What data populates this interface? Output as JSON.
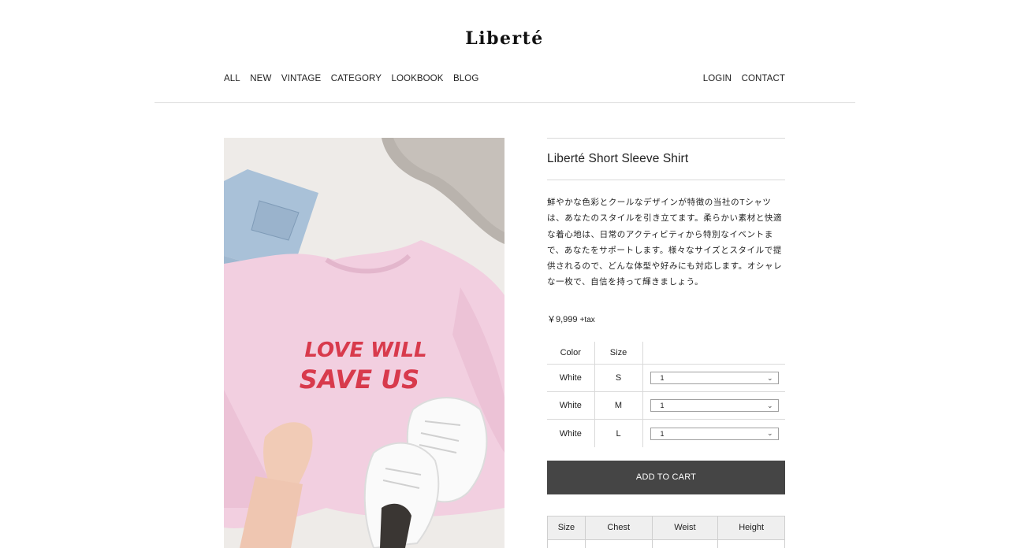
{
  "brand": "Liberté",
  "nav": {
    "left": [
      "ALL",
      "NEW",
      "VINTAGE",
      "CATEGORY",
      "LOOKBOOK",
      "BLOG"
    ],
    "right": [
      "LOGIN",
      "CONTACT"
    ]
  },
  "photo": {
    "print_line1": "LOVE WILL",
    "print_line2": "SAVE US"
  },
  "product": {
    "title": "Liberté Short Sleeve Shirt",
    "description": "鮮やかな色彩とクールなデザインが特徴の当社のTシャツは、あなたのスタイルを引き立てます。柔らかい素材と快適な着心地は、日常のアクティビティから特別なイベントまで、あなたをサポートします。様々なサイズとスタイルで提供されるので、どんな体型や好みにも対応します。オシャレな一枚で、自信を持って輝きましょう。",
    "price": "￥9,999",
    "tax": "+tax"
  },
  "variants": {
    "headers": [
      "Color",
      "Size"
    ],
    "rows": [
      {
        "color": "White",
        "size": "S",
        "qty": "1"
      },
      {
        "color": "White",
        "size": "M",
        "qty": "1"
      },
      {
        "color": "White",
        "size": "L",
        "qty": "1"
      }
    ]
  },
  "cart_label": "ADD TO CART",
  "size_chart": {
    "headers": [
      "Size",
      "Chest",
      "Weist",
      "Height"
    ]
  }
}
